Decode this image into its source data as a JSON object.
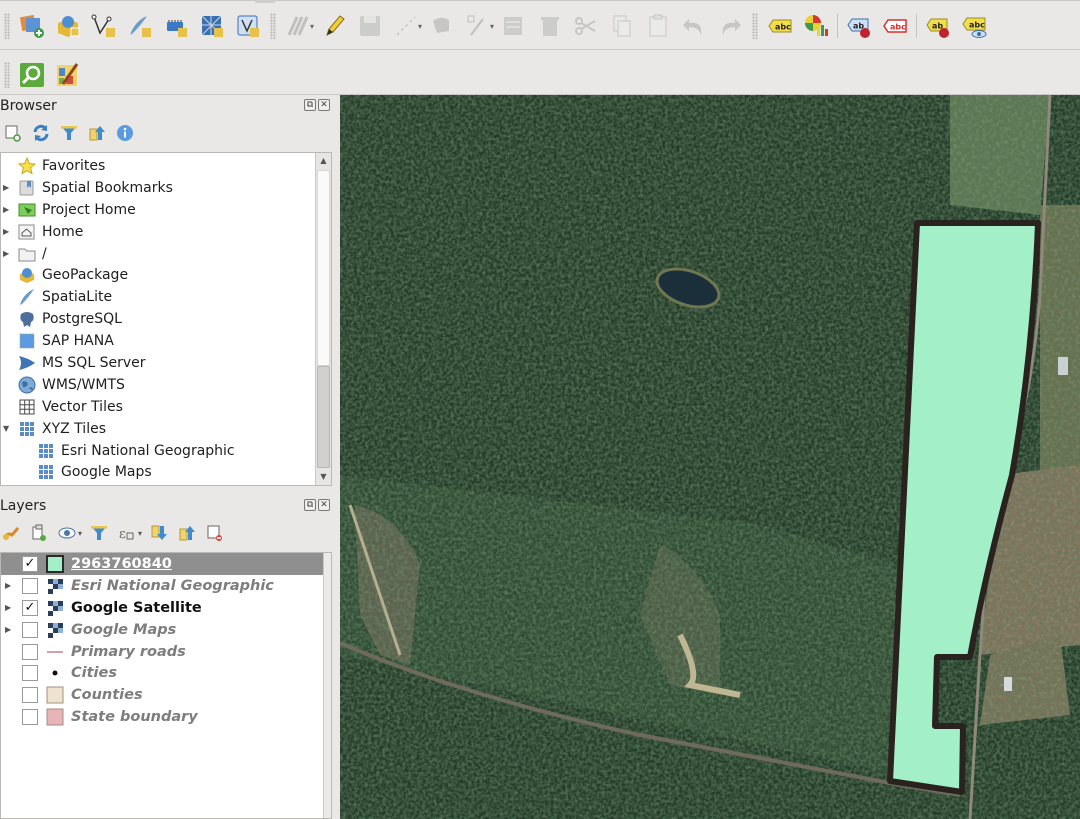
{
  "toolbar_main": {
    "buttons": [
      {
        "icon": "data-source-manager-icon",
        "tooltip": "Open Data Source Manager",
        "enabled": true
      },
      {
        "icon": "new-geopackage-layer-icon",
        "tooltip": "New GeoPackage Layer",
        "enabled": true
      },
      {
        "icon": "new-shapefile-layer-icon",
        "tooltip": "New Shapefile Layer",
        "enabled": true
      },
      {
        "icon": "new-spatialite-layer-icon",
        "tooltip": "New SpatiaLite Layer",
        "enabled": true
      },
      {
        "icon": "new-temporary-layer-icon",
        "tooltip": "New Temporary Scratch Layer",
        "enabled": true
      },
      {
        "icon": "new-mesh-layer-icon",
        "tooltip": "New Mesh Layer",
        "enabled": true
      },
      {
        "icon": "new-virtual-layer-icon",
        "tooltip": "New Virtual Layer",
        "enabled": true
      },
      {
        "icon": "current-edits-icon",
        "enabled": false
      },
      {
        "icon": "toggle-editing-icon",
        "enabled": true
      },
      {
        "icon": "save-edits-icon",
        "enabled": false
      },
      {
        "icon": "digitize-icon",
        "enabled": false
      },
      {
        "icon": "add-polygon-icon",
        "enabled": false
      },
      {
        "icon": "vertex-tool-icon",
        "enabled": false
      },
      {
        "icon": "modify-attributes-icon",
        "enabled": false
      },
      {
        "icon": "delete-selected-icon",
        "enabled": false
      },
      {
        "icon": "cut-features-icon",
        "enabled": false
      },
      {
        "icon": "copy-features-icon",
        "enabled": false
      },
      {
        "icon": "paste-features-icon",
        "enabled": false
      },
      {
        "icon": "undo-icon",
        "enabled": false
      },
      {
        "icon": "redo-icon",
        "enabled": false
      },
      {
        "icon": "labeling-icon",
        "label": "abc",
        "enabled": true
      },
      {
        "icon": "diagram-icon",
        "enabled": true
      },
      {
        "icon": "pin-labels-icon",
        "label": "ab",
        "enabled": true
      },
      {
        "icon": "highlight-pinned-labels-icon",
        "label": "abc",
        "enabled": true
      },
      {
        "icon": "pin-diagrams-icon",
        "label": "ab",
        "enabled": true
      },
      {
        "icon": "show-hide-labels-icon",
        "label": "abc",
        "enabled": true
      }
    ]
  },
  "toolbar_secondary": {
    "buttons": [
      {
        "icon": "identify-zoom-icon"
      },
      {
        "icon": "georeferencer-icon"
      }
    ]
  },
  "browser": {
    "title": "Browser",
    "items": [
      {
        "label": "Favorites",
        "icon": "star-icon",
        "expand": "none",
        "indent": 0
      },
      {
        "label": "Spatial Bookmarks",
        "icon": "bookmark-icon",
        "expand": "collapsed",
        "indent": 0
      },
      {
        "label": "Project Home",
        "icon": "project-home-icon",
        "expand": "collapsed",
        "indent": 0
      },
      {
        "label": "Home",
        "icon": "home-folder-icon",
        "expand": "collapsed",
        "indent": 0
      },
      {
        "label": "/",
        "icon": "folder-icon",
        "expand": "collapsed",
        "indent": 0
      },
      {
        "label": "GeoPackage",
        "icon": "geopackage-icon",
        "expand": "none",
        "indent": 0
      },
      {
        "label": "SpatiaLite",
        "icon": "spatialite-icon",
        "expand": "none",
        "indent": 0
      },
      {
        "label": "PostgreSQL",
        "icon": "postgresql-icon",
        "expand": "none",
        "indent": 0
      },
      {
        "label": "SAP HANA",
        "icon": "sap-hana-icon",
        "expand": "none",
        "indent": 0
      },
      {
        "label": "MS SQL Server",
        "icon": "mssql-icon",
        "expand": "none",
        "indent": 0
      },
      {
        "label": "WMS/WMTS",
        "icon": "wms-icon",
        "expand": "none",
        "indent": 0
      },
      {
        "label": "Vector Tiles",
        "icon": "vector-tiles-icon",
        "expand": "none",
        "indent": 0
      },
      {
        "label": "XYZ Tiles",
        "icon": "xyz-tiles-icon",
        "expand": "expanded",
        "indent": 0
      },
      {
        "label": "Esri National Geographic",
        "icon": "xyz-tiles-icon",
        "expand": "none",
        "indent": 1
      },
      {
        "label": "Google Maps",
        "icon": "xyz-tiles-icon",
        "expand": "none",
        "indent": 1
      },
      {
        "label": "Google Satellite",
        "icon": "xyz-tiles-icon",
        "expand": "none",
        "indent": 1
      }
    ]
  },
  "layers": {
    "title": "Layers",
    "items": [
      {
        "name": "2963760840",
        "checked": true,
        "visible_style": "selected",
        "symbol": "fill",
        "symbol_color": "#a3f0c8",
        "expandable": false
      },
      {
        "name": "Esri National Geographic",
        "checked": false,
        "visible_style": "off",
        "symbol": "raster",
        "expandable": true
      },
      {
        "name": "Google Satellite",
        "checked": true,
        "visible_style": "on",
        "symbol": "raster",
        "expandable": true
      },
      {
        "name": "Google Maps",
        "checked": false,
        "visible_style": "off",
        "symbol": "raster",
        "expandable": true
      },
      {
        "name": "Primary roads",
        "checked": false,
        "visible_style": "off",
        "symbol": "line",
        "symbol_color": "#d4a0aa",
        "expandable": false
      },
      {
        "name": "Cities",
        "checked": false,
        "visible_style": "off",
        "symbol": "point",
        "symbol_color": "#111111",
        "expandable": false
      },
      {
        "name": "Counties",
        "checked": false,
        "visible_style": "off",
        "symbol": "fill",
        "symbol_color": "#efe3cf",
        "expandable": false
      },
      {
        "name": "State boundary",
        "checked": false,
        "visible_style": "off",
        "symbol": "fill",
        "symbol_color": "#e8b4b8",
        "expandable": false
      }
    ]
  },
  "map": {
    "basemap": "Google Satellite",
    "feature_layer": "2963760840",
    "feature_fill": "#a3f0c8",
    "feature_stroke": "#2a221e",
    "forest_color": "#1f3522"
  }
}
